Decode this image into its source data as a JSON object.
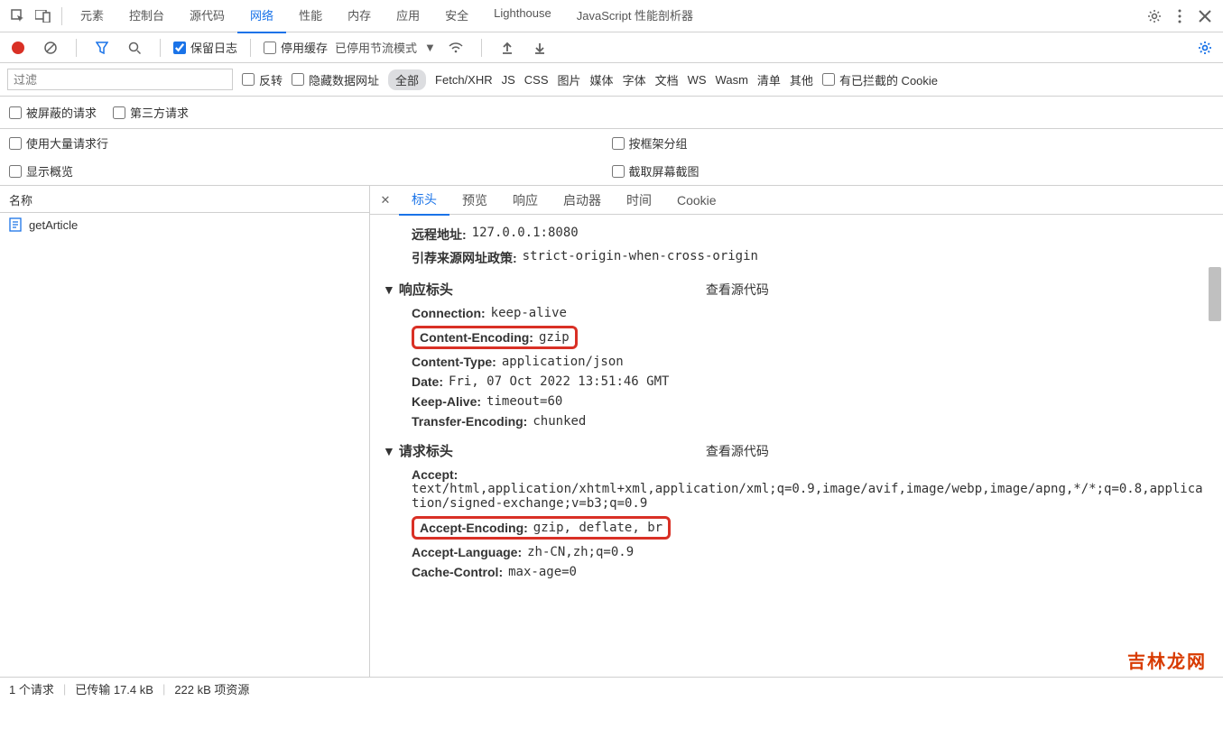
{
  "tabs_main": [
    "元素",
    "控制台",
    "源代码",
    "网络",
    "性能",
    "内存",
    "应用",
    "安全",
    "Lighthouse",
    "JavaScript 性能剖析器"
  ],
  "tabs_main_active": 3,
  "toolbar2": {
    "preserve_log": "保留日志",
    "disable_cache": "停用缓存",
    "throttle": "已停用节流模式"
  },
  "filter_placeholder": "过滤",
  "type_filters": {
    "invert": "反转",
    "hide_data": "隐藏数据网址",
    "all": "全部",
    "items": [
      "Fetch/XHR",
      "JS",
      "CSS",
      "图片",
      "媒体",
      "字体",
      "文档",
      "WS",
      "Wasm",
      "清单",
      "其他"
    ],
    "blocked_cookies": "有已拦截的 Cookie"
  },
  "row4": {
    "blocked": "被屏蔽的请求",
    "thirdparty": "第三方请求"
  },
  "opts": {
    "large": "使用大量请求行",
    "overview": "显示概览",
    "group": "按框架分组",
    "capture": "截取屏幕截图"
  },
  "left": {
    "header": "名称",
    "request": "getArticle"
  },
  "detail_tabs": [
    "标头",
    "预览",
    "响应",
    "启动器",
    "时间",
    "Cookie"
  ],
  "detail_tabs_active": 0,
  "general": {
    "remote_label": "远程地址:",
    "remote_value": "127.0.0.1:8080",
    "referrer_label": "引荐来源网址政策:",
    "referrer_value": "strict-origin-when-cross-origin"
  },
  "sections": {
    "response": "响应标头",
    "request": "请求标头",
    "view_source": "查看源代码"
  },
  "response_headers": [
    {
      "k": "Connection:",
      "v": "keep-alive"
    },
    {
      "k": "Content-Encoding:",
      "v": "gzip"
    },
    {
      "k": "Content-Type:",
      "v": "application/json"
    },
    {
      "k": "Date:",
      "v": "Fri, 07 Oct 2022 13:51:46 GMT"
    },
    {
      "k": "Keep-Alive:",
      "v": "timeout=60"
    },
    {
      "k": "Transfer-Encoding:",
      "v": "chunked"
    }
  ],
  "request_headers": [
    {
      "k": "Accept:",
      "v": "text/html,application/xhtml+xml,application/xml;q=0.9,image/avif,image/webp,image/apng,*/*;q=0.8,application/signed-exchange;v=b3;q=0.9"
    },
    {
      "k": "Accept-Encoding:",
      "v": "gzip, deflate, br"
    },
    {
      "k": "Accept-Language:",
      "v": "zh-CN,zh;q=0.9"
    },
    {
      "k": "Cache-Control:",
      "v": "max-age=0"
    }
  ],
  "status": {
    "requests": "1 个请求",
    "transferred": "已传输 17.4 kB",
    "resources": "222 kB 项资源"
  },
  "watermark": "吉林龙网"
}
